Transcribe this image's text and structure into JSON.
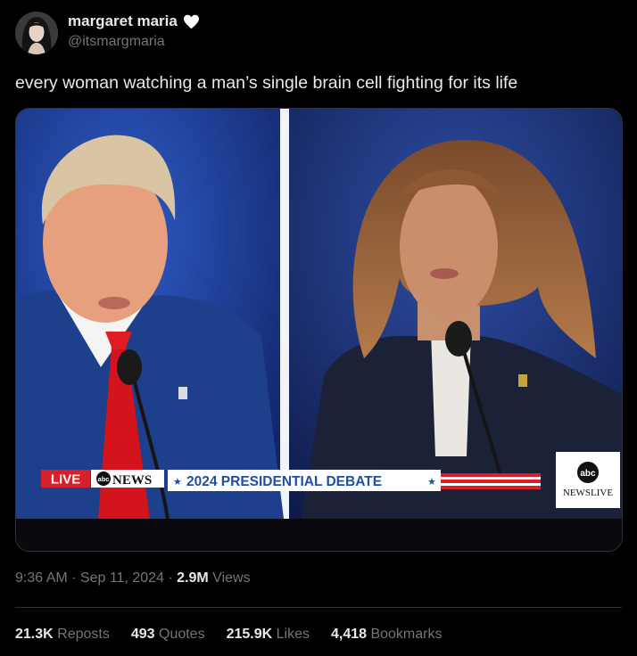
{
  "author": {
    "display_name": "margaret maria",
    "handle": "@itsmargmaria",
    "badge_icon": "white-heart-icon"
  },
  "tweet": {
    "text": "every woman watching a man’s single brain cell fighting for its life"
  },
  "media": {
    "chyron": {
      "live": "LIVE",
      "network": "NEWS",
      "network_logo": "abc",
      "debate_title": "2024 PRESIDENTIAL DEBATE",
      "star": "★"
    },
    "corner_logo": {
      "logo": "abc",
      "text": "NEWSLIVE"
    }
  },
  "meta": {
    "time": "9:36 AM",
    "sep1": " · ",
    "date": "Sep 11, 2024",
    "sep2": " · ",
    "views_count": "2.9M",
    "views_label": " Views"
  },
  "stats": {
    "reposts_count": "21.3K",
    "reposts_label": " Reposts",
    "quotes_count": "493",
    "quotes_label": " Quotes",
    "likes_count": "215.9K",
    "likes_label": " Likes",
    "bookmarks_count": "4,418",
    "bookmarks_label": " Bookmarks"
  },
  "colors": {
    "background": "#000000",
    "text_primary": "#e7e9ea",
    "text_secondary": "#71767b",
    "divider": "#2f3336",
    "chyron_blue": "#1f4fa3",
    "chyron_red": "#d8202a"
  }
}
